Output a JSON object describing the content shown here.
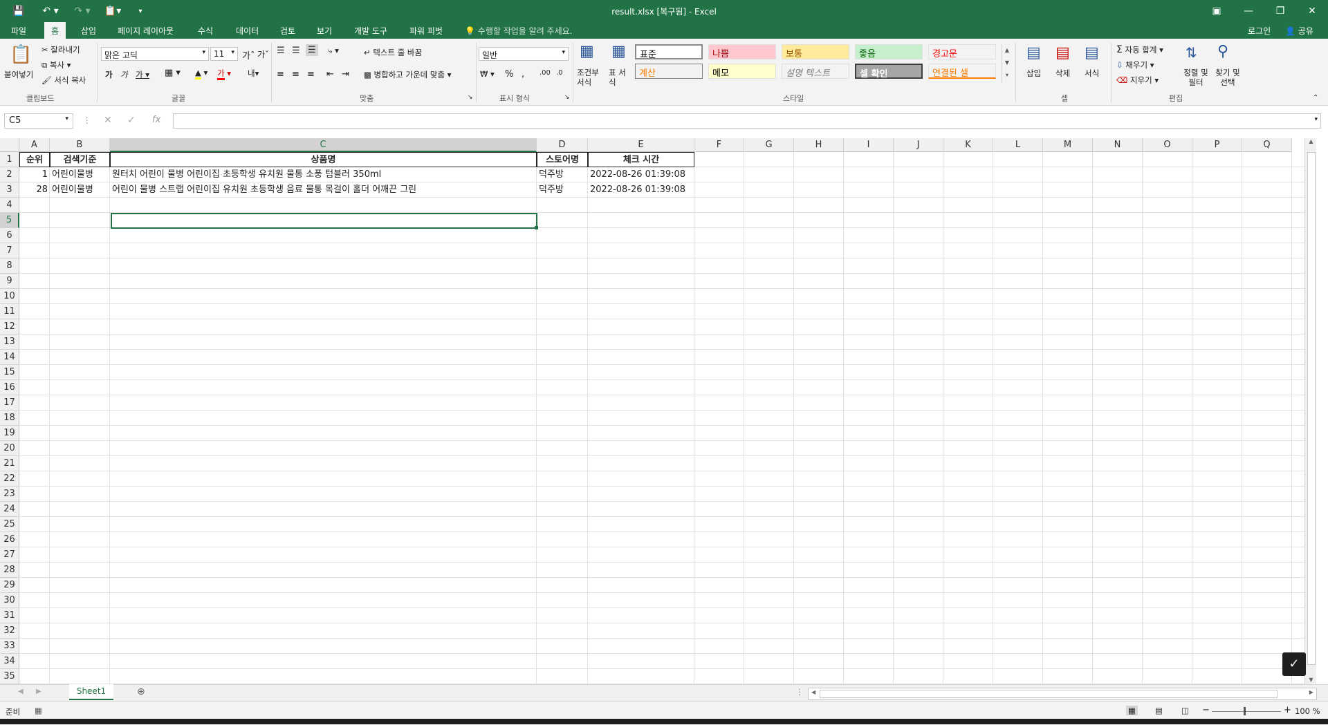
{
  "window": {
    "title": "result.xlsx [복구됨] - Excel",
    "login": "로그인",
    "share": "공유"
  },
  "tabs": [
    "파일",
    "홈",
    "삽입",
    "페이지 레이아웃",
    "수식",
    "데이터",
    "검토",
    "보기",
    "개발 도구",
    "파워 피벗"
  ],
  "tell_me": "수행할 작업을 알려 주세요.",
  "ribbon": {
    "clipboard": {
      "paste": "붙여넣기",
      "cut": "잘라내기",
      "copy": "복사",
      "format_painter": "서식 복사",
      "label": "클립보드"
    },
    "font": {
      "name": "맑은 고딕",
      "size": "11",
      "label": "글꼴"
    },
    "alignment": {
      "wrap": "텍스트 줄 바꿈",
      "merge": "병합하고 가운데 맞춤",
      "label": "맞춤"
    },
    "number": {
      "format": "일반",
      "label": "표시 형식"
    },
    "styles": {
      "conditional": "조건부 서식",
      "table": "표 서식",
      "label": "스타일",
      "cells": [
        {
          "text": "표준",
          "bg": "#ffffff",
          "fg": "#000000"
        },
        {
          "text": "나쁨",
          "bg": "#ffc7ce",
          "fg": "#9c0006"
        },
        {
          "text": "보통",
          "bg": "#ffeb9c",
          "fg": "#9c5700"
        },
        {
          "text": "좋음",
          "bg": "#c6efce",
          "fg": "#006100"
        },
        {
          "text": "경고문",
          "bg": "#f3f3f3",
          "fg": "#ff0000"
        },
        {
          "text": "계산",
          "bg": "#f2f2f2",
          "fg": "#fa7d00"
        },
        {
          "text": "메모",
          "bg": "#ffffcc",
          "fg": "#000000"
        },
        {
          "text": "설명 텍스트",
          "bg": "#f3f3f3",
          "fg": "#7f7f7f"
        },
        {
          "text": "셀 확인",
          "bg": "#a5a5a5",
          "fg": "#ffffff"
        },
        {
          "text": "연결된 셀",
          "bg": "#f3f3f3",
          "fg": "#fa7d00"
        }
      ]
    },
    "cells_group": {
      "insert": "삽입",
      "delete": "삭제",
      "format": "서식",
      "label": "셀"
    },
    "editing": {
      "autosum": "자동 합계",
      "fill": "채우기",
      "clear": "지우기",
      "sort": "정렬 및 필터",
      "find": "찾기 및 선택",
      "label": "편집"
    }
  },
  "formula_bar": {
    "name_box": "C5",
    "formula": ""
  },
  "columns": [
    "A",
    "B",
    "C",
    "D",
    "E",
    "F",
    "G",
    "H",
    "I",
    "J",
    "K",
    "L",
    "M",
    "N",
    "O",
    "P",
    "Q"
  ],
  "selected_column": "C",
  "selected_row": 5,
  "rows_count": 35,
  "sheet": {
    "header": [
      "순위",
      "검색기준",
      "상품명",
      "스토어명",
      "체크 시간"
    ],
    "rows": [
      [
        "1",
        "어린이물병",
        "원터치 어린이 물병 어린이집 초등학생 유치원 물통 소풍 텀블러 350ml",
        "덕주방",
        "2022-08-26 01:39:08"
      ],
      [
        "28",
        "어린이물병",
        "어린이 물병 스트랩 어린이집 유치원 초등학생 음료 물통 목걸이 홀더 어깨끈 그린",
        "덕주방",
        "2022-08-26 01:39:08"
      ]
    ]
  },
  "sheet_tabs": [
    "Sheet1"
  ],
  "status": {
    "ready": "준비",
    "zoom": "100 %"
  }
}
